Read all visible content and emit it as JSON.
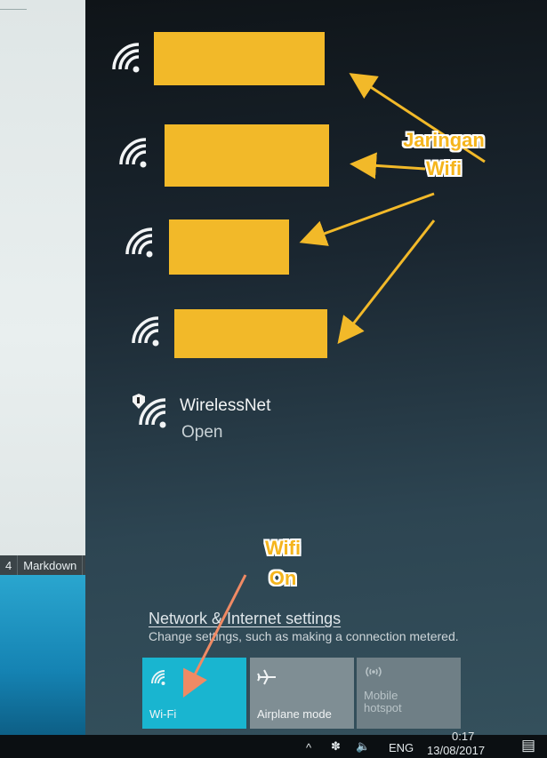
{
  "background_doc": {
    "status_cells": [
      "4",
      "Markdown"
    ]
  },
  "networks": [
    {
      "name": "",
      "redacted": true
    },
    {
      "name": "",
      "redacted": true
    },
    {
      "name": "",
      "redacted": true
    },
    {
      "name": "",
      "redacted": true
    },
    {
      "name": "WirelessNet",
      "status": "Open",
      "secured": false
    }
  ],
  "settings": {
    "link": "Network & Internet settings",
    "description": "Change settings, such as making a connection metered."
  },
  "quick_actions": [
    {
      "label": "Wi-Fi",
      "active": true,
      "icon": "wifi-icon"
    },
    {
      "label": "Airplane mode",
      "active": false,
      "icon": "airplane-icon"
    },
    {
      "label_line1": "Mobile",
      "label_line2": "hotspot",
      "active": false,
      "icon": "hotspot-icon"
    }
  ],
  "taskbar": {
    "language": "ENG",
    "time": "0:17",
    "date": "13/08/2017"
  },
  "annotations": {
    "networks_line1": "Jaringan",
    "networks_line2": "Wifi",
    "wifi_on_line1": "Wifi",
    "wifi_on_line2": "On"
  },
  "colors": {
    "redaction": "#f2b929",
    "wifi_tile_active": "#19b5d0",
    "annotation_text": "#f5b51d",
    "wifi_arrow": "#f08a64"
  }
}
